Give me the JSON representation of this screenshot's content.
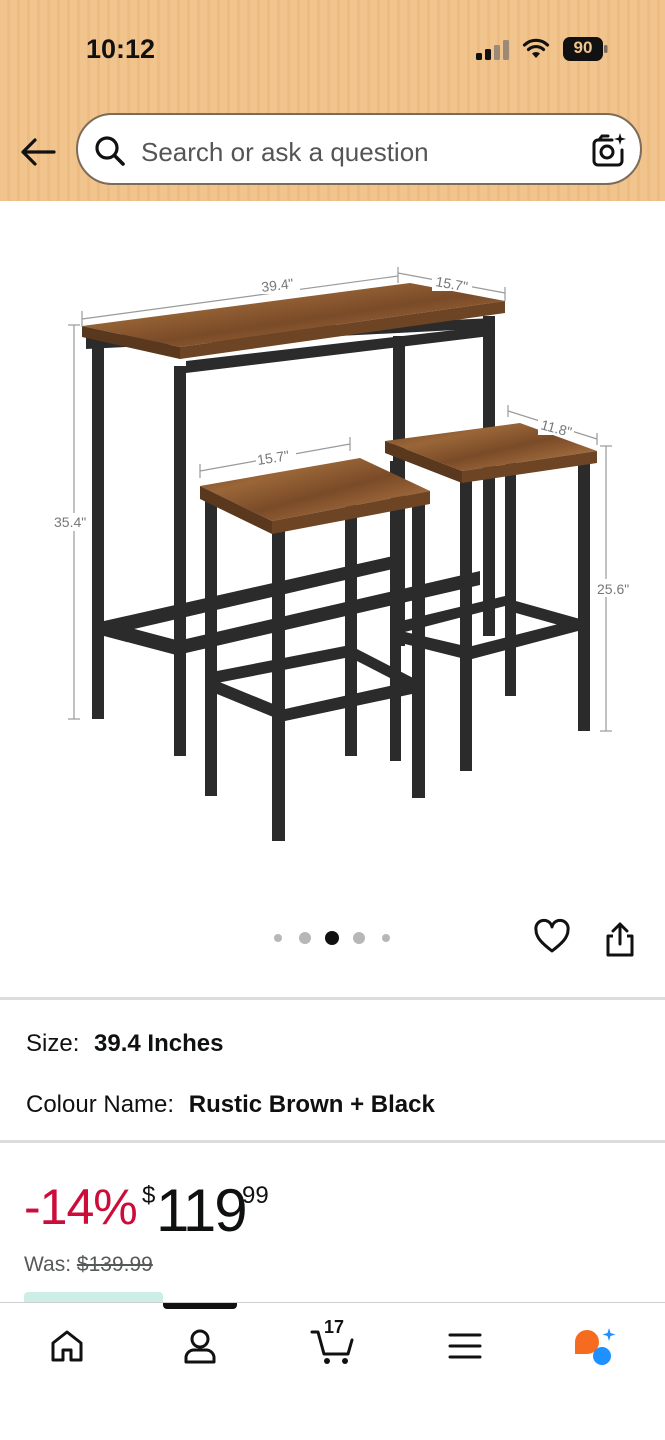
{
  "status_bar": {
    "time": "10:12",
    "battery": "90"
  },
  "search": {
    "placeholder": "Search or ask a question"
  },
  "image": {
    "dim_table_width": "39.4\"",
    "dim_table_depth": "15.7\"",
    "dim_table_height": "35.4\"",
    "dim_stool_width": "15.7\"",
    "dim_stool_depth": "11.8\"",
    "dim_stool_height": "25.6\"",
    "carousel_count": 5,
    "carousel_active": 3
  },
  "specs": {
    "size_label": "Size:",
    "size_value": "39.4 Inches",
    "colour_label": "Colour Name:",
    "colour_value": "Rustic Brown + Black"
  },
  "pricing": {
    "discount": "-14%",
    "currency": "$",
    "price_whole": "119",
    "price_fraction": "99",
    "was_label": "Was:",
    "was_price": "$139.99"
  },
  "bottom_nav": {
    "items": [
      "home-icon",
      "account-icon",
      "cart-icon",
      "menu-icon",
      "rufus-assistant-icon"
    ],
    "cart_count": "17"
  },
  "colors": {
    "header_bg": "#f2c48d",
    "discount_red": "#cc0c39",
    "wood": "#8a5a33",
    "metal": "#2a2a2a"
  }
}
